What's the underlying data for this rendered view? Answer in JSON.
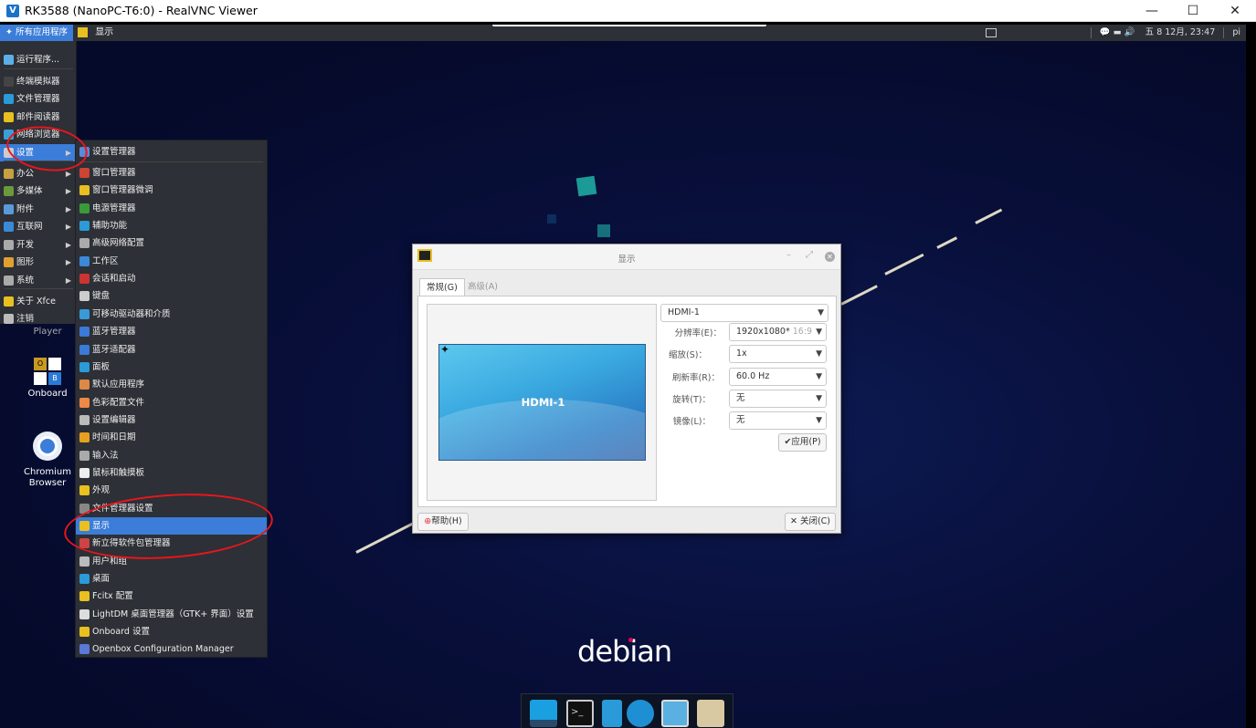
{
  "window": {
    "title": "RK3588 (NanoPC-T6:0) - RealVNC Viewer",
    "minimize": "—",
    "maximize": "☐",
    "close": "✕"
  },
  "panel": {
    "apps_button": "所有应用程序",
    "task_title": "显示",
    "tray_datetime": "五 8 12月, 23:47",
    "tray_user": "pi"
  },
  "menu_main": {
    "items": [
      {
        "label": "运行程序..."
      },
      {
        "label": "终端模拟器"
      },
      {
        "label": "文件管理器"
      },
      {
        "label": "邮件阅读器"
      },
      {
        "label": "网络浏览器"
      },
      {
        "label": "设置"
      },
      {
        "label": "办公"
      },
      {
        "label": "多媒体"
      },
      {
        "label": "附件"
      },
      {
        "label": "互联网"
      },
      {
        "label": "开发"
      },
      {
        "label": "图形"
      },
      {
        "label": "系统"
      },
      {
        "label": "关于 Xfce"
      },
      {
        "label": "注销"
      }
    ]
  },
  "menu_settings": {
    "items": [
      {
        "label": "设置管理器"
      },
      {
        "label": "窗口管理器"
      },
      {
        "label": "窗口管理器微调"
      },
      {
        "label": "电源管理器"
      },
      {
        "label": "辅助功能"
      },
      {
        "label": "高级网络配置"
      },
      {
        "label": "工作区"
      },
      {
        "label": "会话和启动"
      },
      {
        "label": "键盘"
      },
      {
        "label": "可移动驱动器和介质"
      },
      {
        "label": "蓝牙管理器"
      },
      {
        "label": "蓝牙适配器"
      },
      {
        "label": "面板"
      },
      {
        "label": "默认应用程序"
      },
      {
        "label": "色彩配置文件"
      },
      {
        "label": "设置编辑器"
      },
      {
        "label": "时间和日期"
      },
      {
        "label": "输入法"
      },
      {
        "label": "鼠标和触摸板"
      },
      {
        "label": "外观"
      },
      {
        "label": "文件管理器设置"
      },
      {
        "label": "显示"
      },
      {
        "label": "新立得软件包管理器"
      },
      {
        "label": "用户和组"
      },
      {
        "label": "桌面"
      },
      {
        "label": "Fcitx 配置"
      },
      {
        "label": "LightDM 桌面管理器（GTK+ 界面）设置"
      },
      {
        "label": "Onboard 设置"
      },
      {
        "label": "Openbox Configuration Manager"
      }
    ]
  },
  "desktop_icons": {
    "player": "Player",
    "onboard": "Onboard",
    "chromium": "Chromium Browser"
  },
  "wallpaper": {
    "logo_text": "debian"
  },
  "dialog": {
    "title": "显示",
    "tabs": [
      "常规(G)",
      "高级(A)"
    ],
    "monitor_label": "HDMI-1",
    "output_select": "HDMI-1",
    "fields": [
      {
        "label": "分辨率(E)：",
        "value": "1920x1080*",
        "extra": "16:9"
      },
      {
        "label": "缩放(S)：",
        "value": "1x"
      },
      {
        "label": "刷新率(R)：",
        "value": "60.0 Hz"
      },
      {
        "label": "旋转(T)：",
        "value": "无"
      },
      {
        "label": "镜像(L)：",
        "value": "无"
      }
    ],
    "apply_button": "应用(P)",
    "help_button": "帮助(H)",
    "close_button": "关闭(C)"
  },
  "colors": {
    "menu_bg": "#2d3036",
    "highlight": "#3b7dd8",
    "annotation_red": "#e8161c",
    "wallpaper_bg": "#080f3a"
  }
}
